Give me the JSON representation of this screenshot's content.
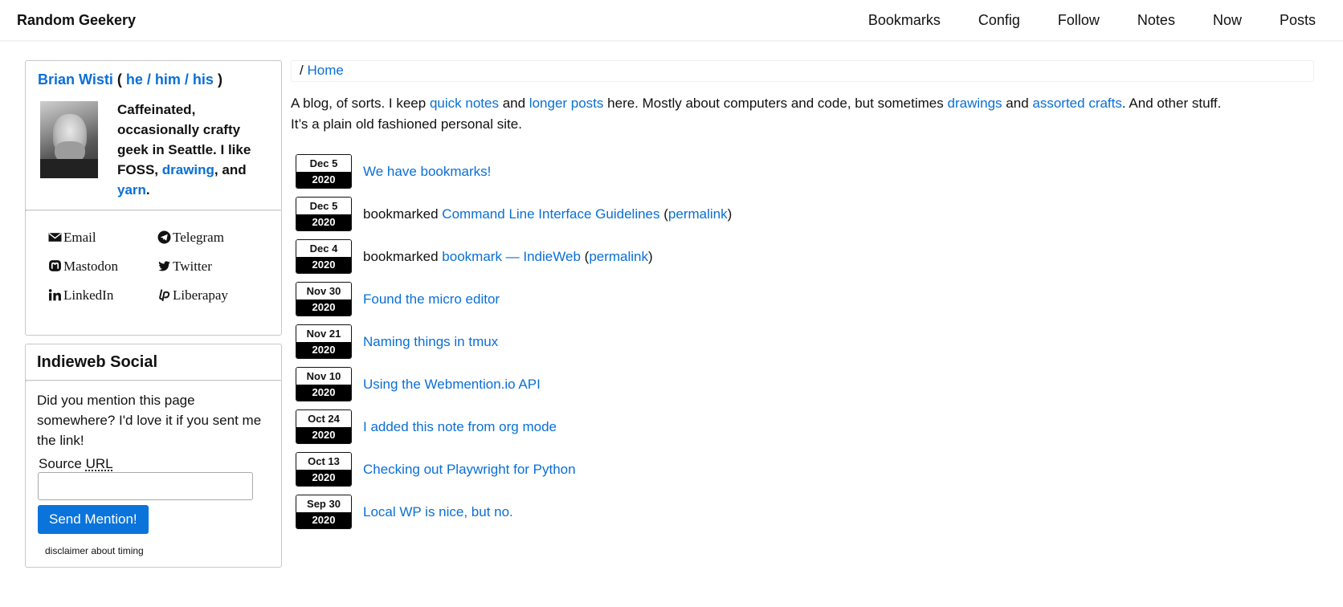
{
  "site": {
    "title": "Random Geekery",
    "nav": [
      "Bookmarks",
      "Config",
      "Follow",
      "Notes",
      "Now",
      "Posts"
    ]
  },
  "profile": {
    "name": "Brian Wisti",
    "pronouns_open": "(",
    "pronouns": "he / him / his",
    "pronouns_close": ")",
    "bio_1": "Caffeinated, occasionally crafty geek in Seattle. I like FOSS,",
    "bio_link1": "drawing",
    "bio_2": ",",
    "bio_3": "and",
    "bio_link2": "yarn",
    "bio_4": ".",
    "socials": [
      {
        "label": "Email",
        "icon": "envelope-icon"
      },
      {
        "label": "Telegram",
        "icon": "telegram-icon"
      },
      {
        "label": "Mastodon",
        "icon": "mastodon-icon"
      },
      {
        "label": "Twitter",
        "icon": "twitter-icon"
      },
      {
        "label": "LinkedIn",
        "icon": "linkedin-icon"
      },
      {
        "label": "Liberapay",
        "icon": "liberapay-icon"
      }
    ]
  },
  "mention": {
    "heading": "Indieweb Social",
    "text": "Did you mention this page somewhere? I'd love it if you sent me the link!",
    "label_pre": "Source",
    "label_abbr": "URL",
    "input_value": "",
    "button": "Send Mention!",
    "disclaimer": "disclaimer about timing"
  },
  "breadcrumb": {
    "sep": "/",
    "home": "Home"
  },
  "intro": {
    "t1": "A blog, of sorts. I keep",
    "l1": "quick notes",
    "t2": "and",
    "l2": "longer posts",
    "t3": "here. Mostly about computers and code, but sometimes",
    "l3": "drawings",
    "t4": "and",
    "l4": "assorted crafts",
    "t5": ". And other stuff. It’s a plain old fashioned personal site."
  },
  "entries": [
    {
      "md": "Dec 5",
      "yr": "2020",
      "type": "post",
      "title": "We have bookmarks!"
    },
    {
      "md": "Dec 5",
      "yr": "2020",
      "type": "bookmark",
      "prefix": "bookmarked",
      "title": "Command Line Interface Guidelines",
      "open": "(",
      "permalink": "permalink",
      "close": ")"
    },
    {
      "md": "Dec 4",
      "yr": "2020",
      "type": "bookmark",
      "prefix": "bookmarked",
      "title": "bookmark — IndieWeb",
      "open": "(",
      "permalink": "permalink",
      "close": ")"
    },
    {
      "md": "Nov 30",
      "yr": "2020",
      "type": "post",
      "title": "Found the micro editor"
    },
    {
      "md": "Nov 21",
      "yr": "2020",
      "type": "post",
      "title": "Naming things in tmux"
    },
    {
      "md": "Nov 10",
      "yr": "2020",
      "type": "post",
      "title": "Using the Webmention.io API"
    },
    {
      "md": "Oct 24",
      "yr": "2020",
      "type": "post",
      "title": "I added this note from org mode"
    },
    {
      "md": "Oct 13",
      "yr": "2020",
      "type": "post",
      "title": "Checking out Playwright for Python"
    },
    {
      "md": "Sep 30",
      "yr": "2020",
      "type": "post",
      "title": "Local WP is nice, but no."
    }
  ],
  "colors": {
    "link": "#0a6fd6",
    "button": "#0a74da",
    "date_year_bg": "#000000"
  }
}
